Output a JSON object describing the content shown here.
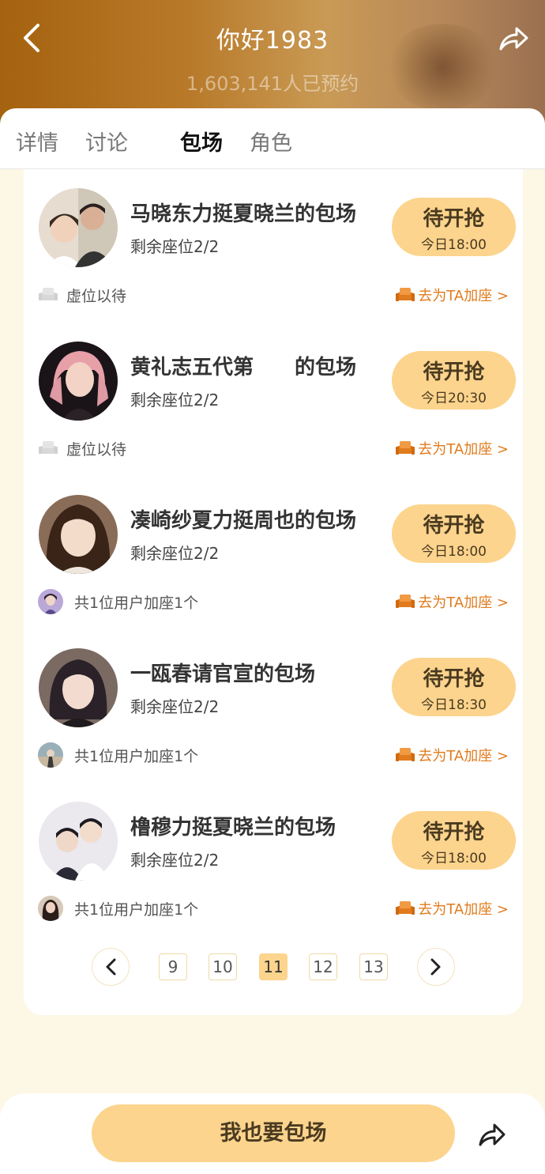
{
  "header": {
    "title": "你好1983",
    "subtitle": "1,603,141人已预约"
  },
  "tabs": [
    {
      "label": "详情"
    },
    {
      "label": "讨论"
    },
    {
      "label": "包场",
      "active": true
    },
    {
      "label": "角色"
    }
  ],
  "items": [
    {
      "title": "马晓东力挺夏晓兰的包场",
      "seats": "剩余座位2/2",
      "btn_main": "待开抢",
      "btn_time": "今日18:00",
      "footer_text": "虚位以待",
      "footer_action": "去为TA加座 >",
      "footer_type": "seat"
    },
    {
      "title": "黄礼志五代第　　的包场",
      "seats": "剩余座位2/2",
      "btn_main": "待开抢",
      "btn_time": "今日20:30",
      "footer_text": "虚位以待",
      "footer_action": "去为TA加座 >",
      "footer_type": "seat"
    },
    {
      "title": "凑崎纱夏力挺周也的包场",
      "seats": "剩余座位2/2",
      "btn_main": "待开抢",
      "btn_time": "今日18:00",
      "footer_text": "共1位用户加座1个",
      "footer_action": "去为TA加座 >",
      "footer_type": "user"
    },
    {
      "title": "一瓯春请官宣的包场",
      "seats": "剩余座位2/2",
      "btn_main": "待开抢",
      "btn_time": "今日18:30",
      "footer_text": "共1位用户加座1个",
      "footer_action": "去为TA加座 >",
      "footer_type": "user"
    },
    {
      "title": "橹穆力挺夏晓兰的包场",
      "seats": "剩余座位2/2",
      "btn_main": "待开抢",
      "btn_time": "今日18:00",
      "footer_text": "共1位用户加座1个",
      "footer_action": "去为TA加座 >",
      "footer_type": "user"
    }
  ],
  "pagination": {
    "pages": [
      "9",
      "10",
      "11",
      "12",
      "13"
    ],
    "current": "11"
  },
  "bottom": {
    "cta_label": "我也要包场"
  },
  "colors": {
    "accent": "#fcd48d",
    "action_orange": "#e07c1e",
    "page_bg": "#fdf8e6"
  },
  "icons": [
    "back-arrow-icon",
    "share-icon",
    "seat-icon",
    "sofa-icon",
    "chevron-left-icon",
    "chevron-right-icon"
  ]
}
